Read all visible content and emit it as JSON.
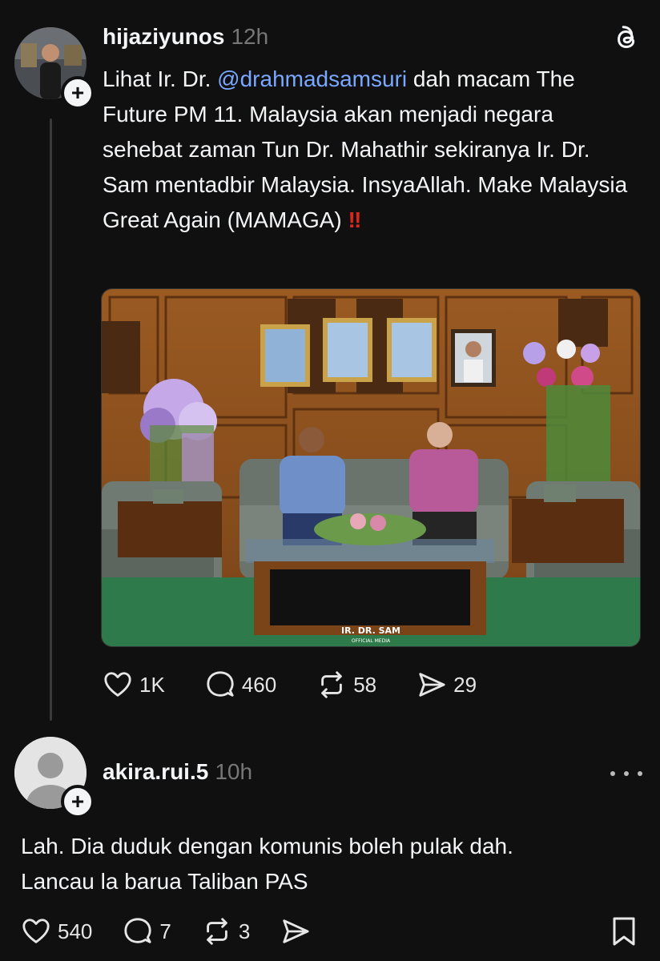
{
  "post1": {
    "username": "hijaziyunos",
    "time": "12h",
    "text_before_mention": "Lihat Ir. Dr. ",
    "mention": "@drahmadsamsuri",
    "text_after_mention": "  dah macam The Future PM 11. Malaysia akan menjadi negara sehebat zaman Tun Dr. Mahathir sekiranya Ir. Dr. Sam mentadbir Malaysia. InsyaAllah. Make Malaysia Great Again (MAMAGA) ",
    "emoji": "‼",
    "image_watermark": "IR. DR. SAM",
    "image_watermark_sub": "OFFICIAL MEDIA",
    "likes": "1K",
    "comments": "460",
    "reposts": "58",
    "shares": "29"
  },
  "post2": {
    "username": "akira.rui.5",
    "time": "10h",
    "line1": "Lah. Dia duduk dengan komunis boleh pulak dah.",
    "line2": "Lancau la barua Taliban PAS",
    "likes": "540",
    "comments": "7",
    "reposts": "3"
  },
  "icons": {
    "threads_logo": "threads-logo-icon",
    "more": "more-options-icon",
    "like": "heart-icon",
    "comment": "comment-icon",
    "repost": "repost-icon",
    "share": "send-icon",
    "bookmark": "bookmark-icon",
    "follow": "plus-icon"
  },
  "colors": {
    "background": "#101010",
    "text": "#f3f5f7",
    "muted": "#777777",
    "mention": "#7aa7ff",
    "emoji": "#e0261b"
  }
}
